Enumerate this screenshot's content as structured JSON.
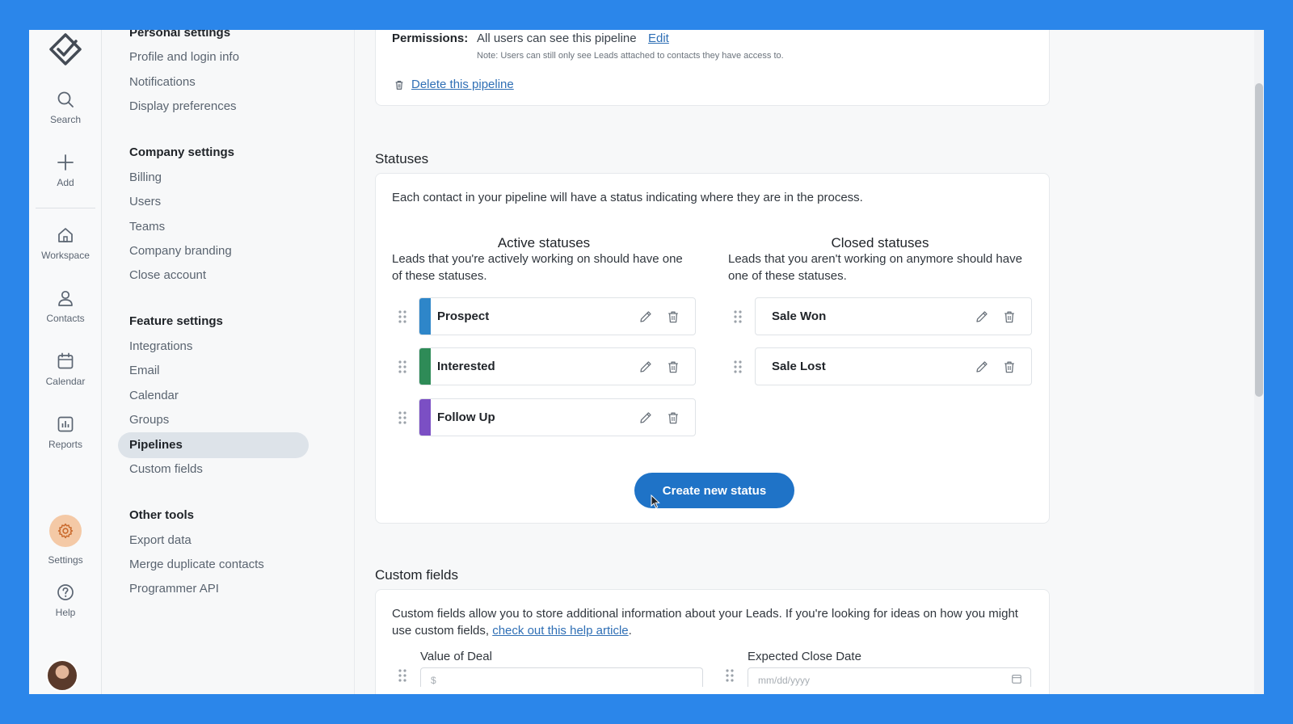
{
  "rail": {
    "items": [
      {
        "label": "Search",
        "icon": "search-icon"
      },
      {
        "label": "Add",
        "icon": "plus-icon"
      },
      {
        "label": "Workspace",
        "icon": "home-icon"
      },
      {
        "label": "Contacts",
        "icon": "person-icon"
      },
      {
        "label": "Calendar",
        "icon": "calendar-icon"
      },
      {
        "label": "Reports",
        "icon": "chart-icon"
      },
      {
        "label": "Settings",
        "icon": "gear-icon"
      },
      {
        "label": "Help",
        "icon": "help-icon"
      }
    ]
  },
  "nav": {
    "personal_heading": "Personal settings",
    "personal": [
      "Profile and login info",
      "Notifications",
      "Display preferences"
    ],
    "company_heading": "Company settings",
    "company": [
      "Billing",
      "Users",
      "Teams",
      "Company branding",
      "Close account"
    ],
    "feature_heading": "Feature settings",
    "feature": [
      "Integrations",
      "Email",
      "Calendar",
      "Groups",
      "Pipelines",
      "Custom fields"
    ],
    "other_heading": "Other tools",
    "other": [
      "Export data",
      "Merge duplicate contacts",
      "Programmer API"
    ]
  },
  "permissions": {
    "label": "Permissions:",
    "value": "All users can see this pipeline",
    "edit": "Edit",
    "note": "Note: Users can still only see Leads attached to contacts they have access to.",
    "delete": "Delete this pipeline"
  },
  "statuses": {
    "title": "Statuses",
    "description": "Each contact in your pipeline will have a status indicating where they are in the process.",
    "active_title": "Active statuses",
    "active_sub": "Leads that you're actively working on should have one of these statuses.",
    "closed_title": "Closed statuses",
    "closed_sub": "Leads that you aren't working on anymore should have one of these statuses.",
    "active": [
      {
        "name": "Prospect",
        "color": "#2e86c9"
      },
      {
        "name": "Interested",
        "color": "#2e8b57"
      },
      {
        "name": "Follow Up",
        "color": "#7b4fc4"
      }
    ],
    "closed": [
      {
        "name": "Sale Won"
      },
      {
        "name": "Sale Lost"
      }
    ],
    "create_button": "Create new status"
  },
  "custom_fields": {
    "title": "Custom fields",
    "description_before": "Custom fields allow you to store additional information about your Leads. If you're looking for ideas on how you might use custom fields, ",
    "description_link": "check out this help article",
    "description_after": ".",
    "fields": [
      {
        "label": "Value of Deal",
        "placeholder": "$"
      },
      {
        "label": "Expected Close Date",
        "placeholder": "mm/dd/yyyy"
      }
    ]
  },
  "colors": {
    "accent": "#1f73c7",
    "frame_background": "#2b86ea",
    "settings_icon_bg": "#f4c9a6"
  }
}
